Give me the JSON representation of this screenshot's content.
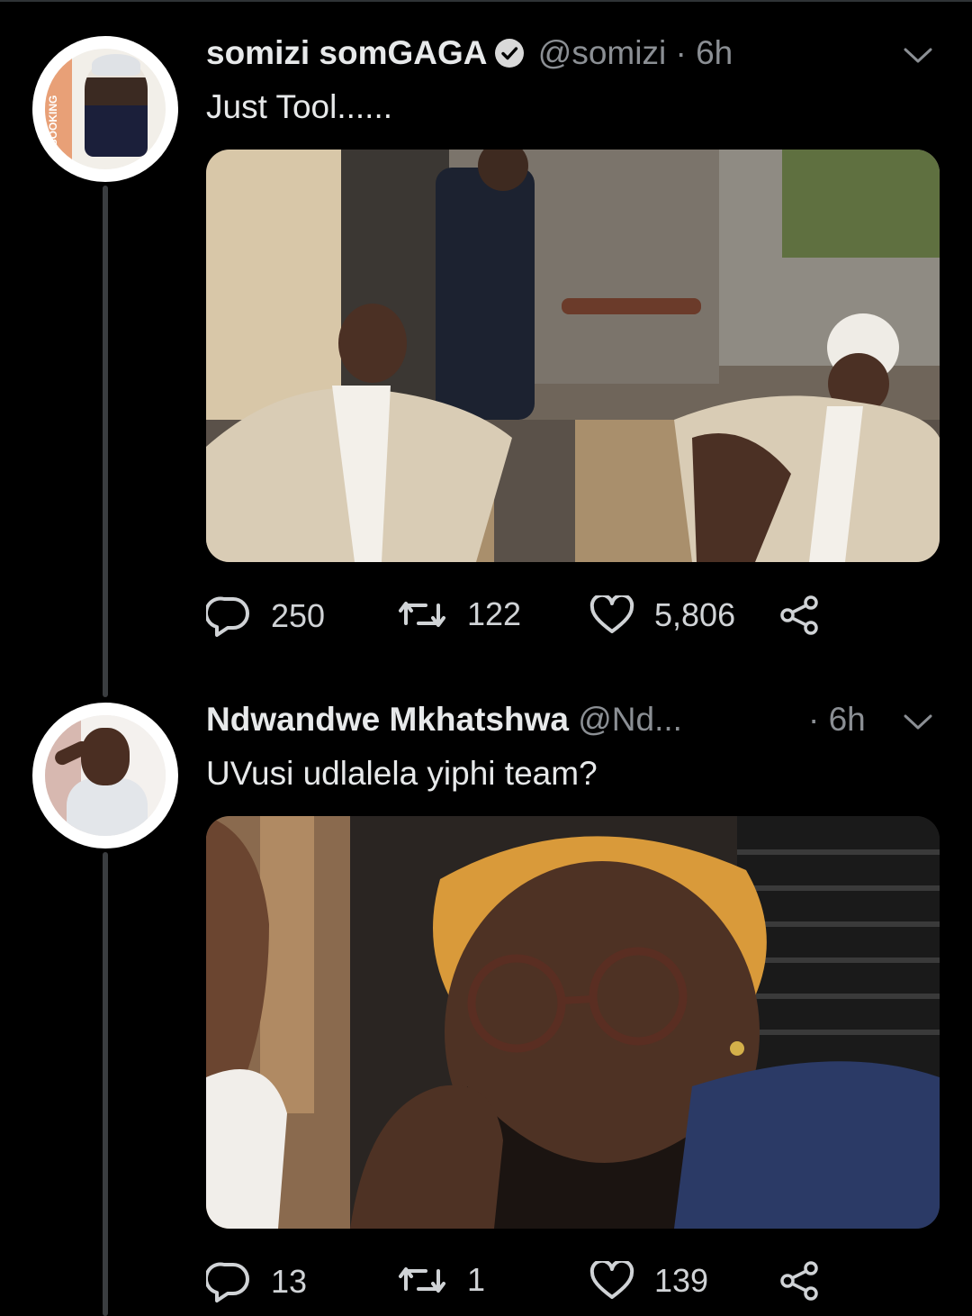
{
  "tweets": [
    {
      "name": "somizi somGAGA",
      "verified": true,
      "handle": "@somizi",
      "time": "· 6h",
      "text": "Just Tool......",
      "avatar_text": "BOOKING",
      "media_icon": "photo",
      "stats": {
        "replies": "250",
        "retweets": "122",
        "likes": "5,806"
      }
    },
    {
      "name": "Ndwandwe Mkhatshwa",
      "verified": false,
      "handle": "@Nd...",
      "time": "· 6h",
      "text": "UVusi udlalela yiphi team?",
      "media_icon": "photo",
      "stats": {
        "replies": "13",
        "retweets": "1",
        "likes": "139"
      }
    }
  ],
  "colors": {
    "background": "#000000",
    "muted": "#8b8f94",
    "text": "#e7e9ea",
    "thread": "#3a3d40"
  },
  "icons": [
    "reply-icon",
    "retweet-icon",
    "like-icon",
    "share-icon",
    "chevron-down-icon",
    "verified-badge-icon"
  ]
}
